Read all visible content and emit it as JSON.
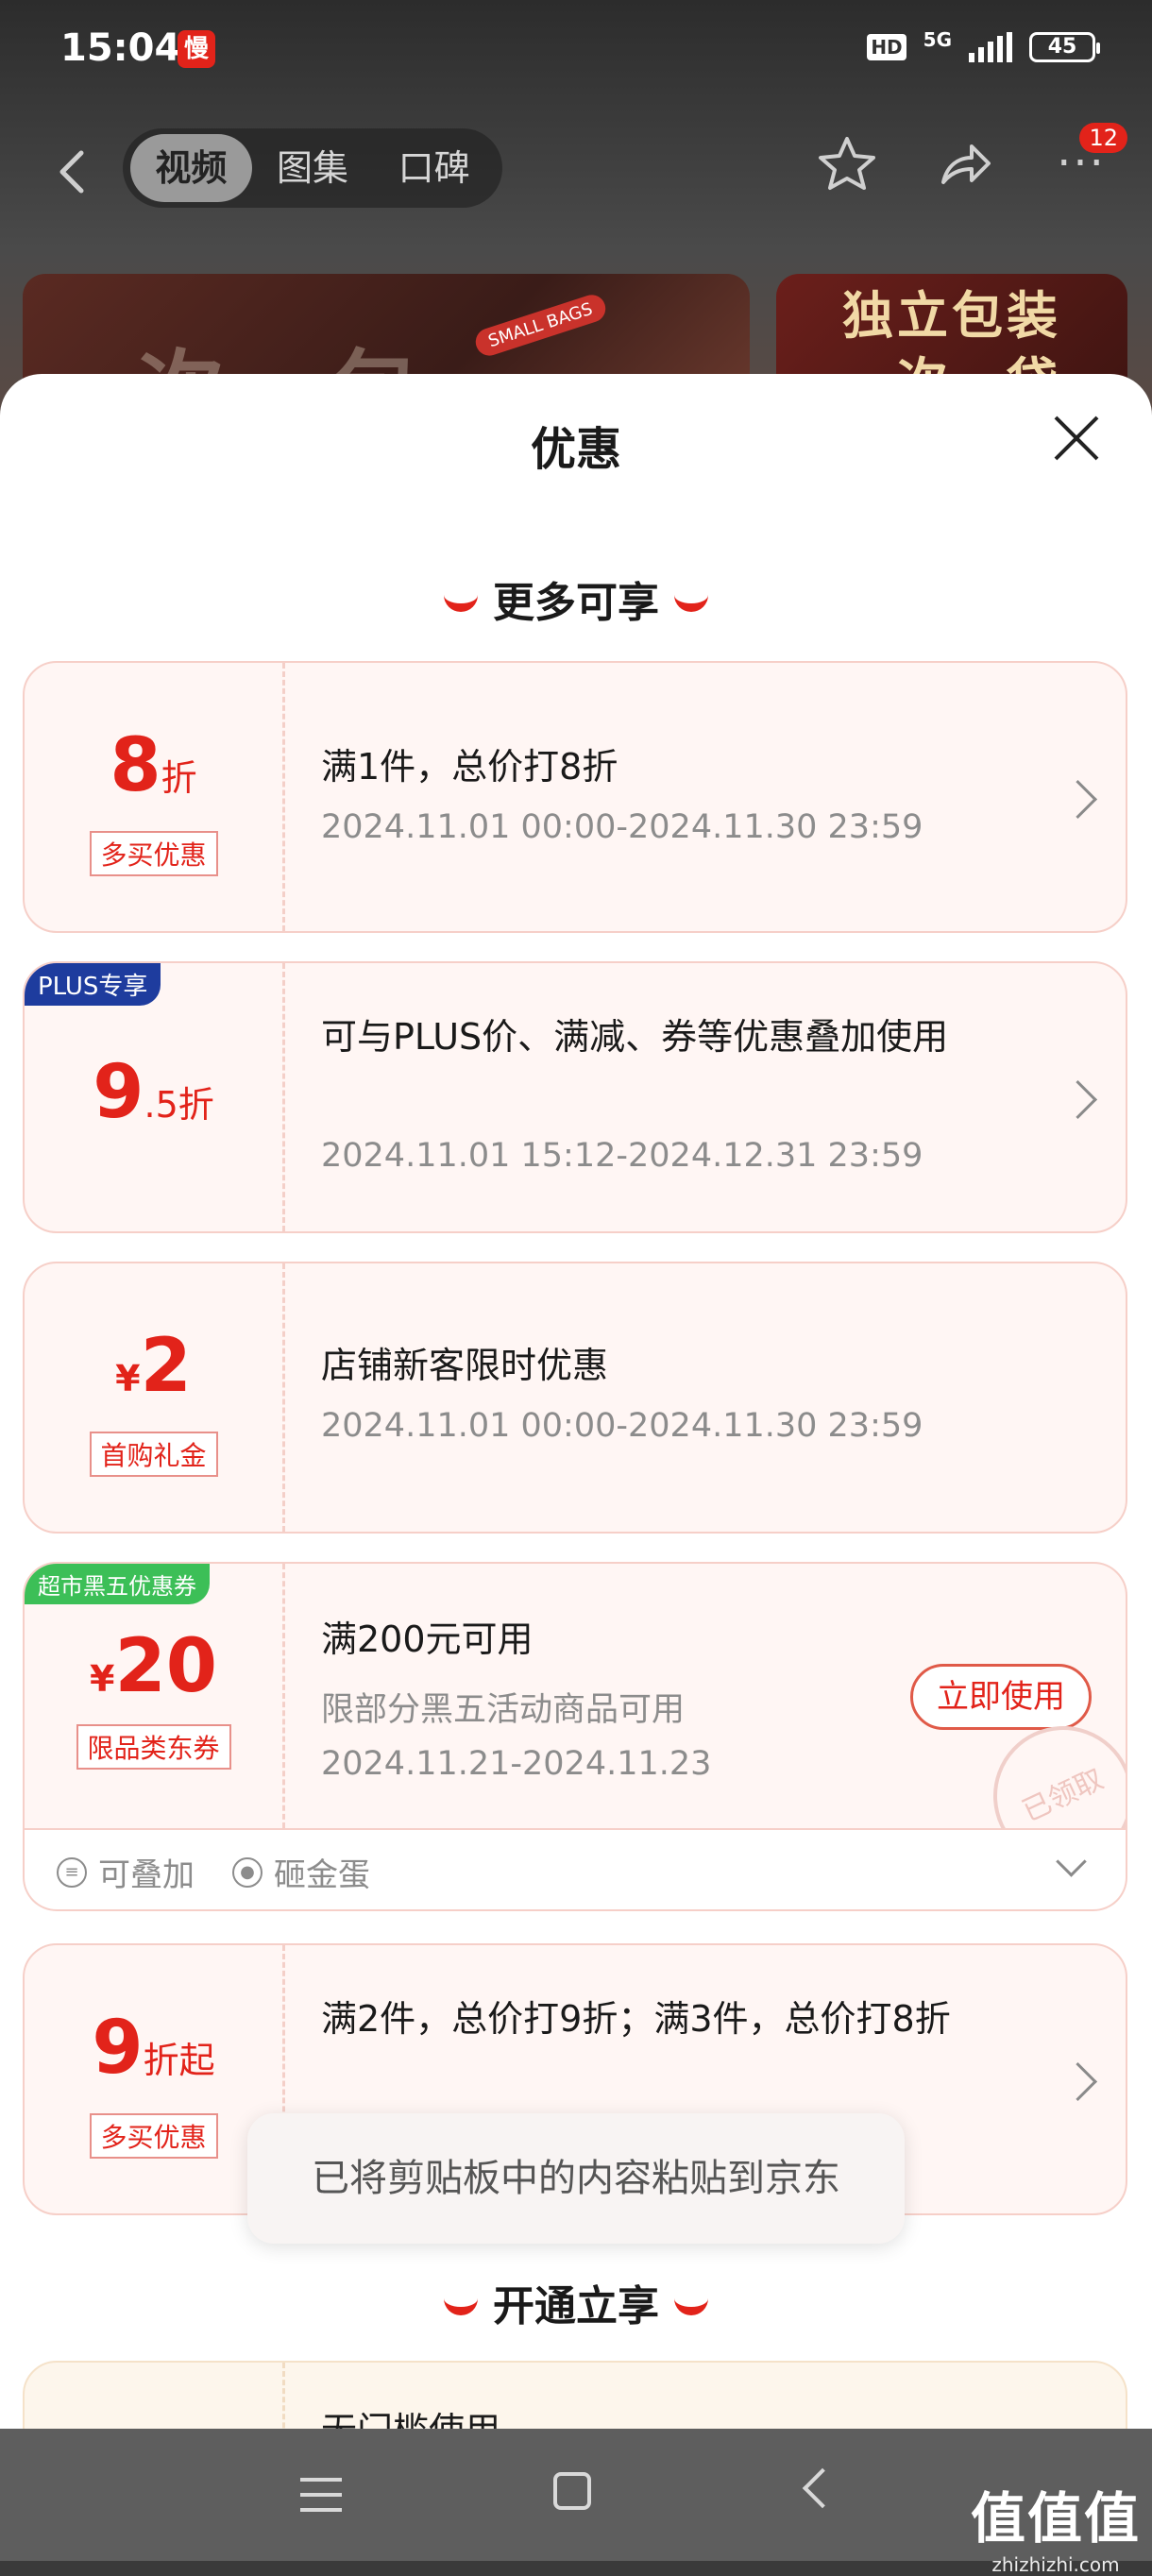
{
  "status_bar": {
    "time": "15:04",
    "app_badge": "慢",
    "hd": "HD",
    "network": "5G",
    "battery": "45"
  },
  "nav": {
    "tabs": [
      {
        "label": "视频"
      },
      {
        "label": "图集"
      },
      {
        "label": "口碑"
      }
    ],
    "active_tab": 0,
    "message_count": "12"
  },
  "thumbs": {
    "left_text": "一次一包",
    "left_tag": "SMALL BAGS",
    "right_text": "独立包装 一次一袋"
  },
  "sheet": {
    "title": "优惠",
    "section_more": "更多可享",
    "section_open": "开通立享"
  },
  "offers": [
    {
      "amount_big": "8",
      "amount_unit": "折",
      "tag": "多买优惠",
      "main": "满1件，总价打8折",
      "sub": "2024.11.01 00:00-2024.11.30 23:59"
    },
    {
      "ribbon": "PLUS专享",
      "amount_big": "9",
      "amount_unit": ".5折",
      "main": "可与PLUS价、满减、券等优惠叠加使用",
      "sub": "2024.11.01 15:12-2024.12.31 23:59"
    },
    {
      "amount_sym": "¥",
      "amount_big": "2",
      "tag": "首购礼金",
      "main": "店铺新客限时优惠",
      "sub": "2024.11.01 00:00-2024.11.30 23:59"
    },
    {
      "ribbon": "超市黑五优惠券",
      "amount_sym": "¥",
      "amount_big": "20",
      "tag": "限品类东券",
      "main": "满200元可用",
      "sub1": "限部分黑五活动商品可用",
      "sub": "2024.11.21-2024.11.23",
      "button": "立即使用",
      "stamp": "已领取",
      "features": [
        "可叠加",
        "砸金蛋"
      ]
    },
    {
      "amount_big": "9",
      "amount_unit": "折起",
      "tag": "多买优惠",
      "main": "满2件，总价打9折；满3件，总价打8折"
    }
  ],
  "last_card_text": "无门槛使用",
  "toast": "已将剪贴板中的内容粘贴到京东",
  "watermark": {
    "big": "值值值",
    "small": "zhizhizhi.com"
  },
  "colors": {
    "accent": "#e2231a",
    "plus": "#1e3c9e",
    "green_ribbon": "#3cbf57"
  }
}
